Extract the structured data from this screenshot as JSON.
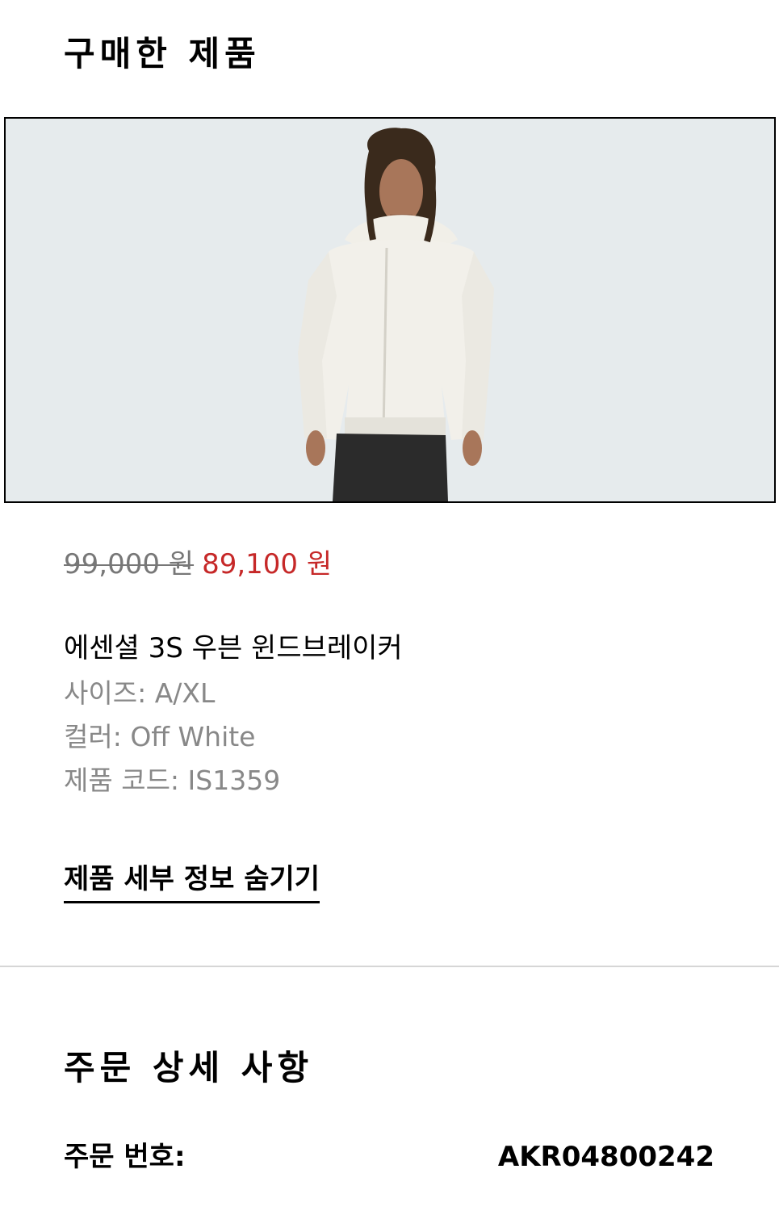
{
  "purchased_section": {
    "title": "구매한 제품"
  },
  "product": {
    "image_icon": "product-photo-man-in-off-white-windbreaker",
    "original_price": "99,000 원",
    "sale_price": "89,100 원",
    "name": "에센셜 3S 우븐 윈드브레이커",
    "size": "사이즈: A/XL",
    "color": "컬러: Off White",
    "code": "제품 코드: IS1359",
    "toggle_label": "제품 세부 정보 숨기기"
  },
  "order_section": {
    "title": "주문 상세 사항",
    "order_number_label": "주문 번호:",
    "order_number_value": "AKR04800242"
  },
  "colors": {
    "sale_price": "#c62828",
    "muted_text": "#888888",
    "image_bg": "#e6ebed"
  }
}
